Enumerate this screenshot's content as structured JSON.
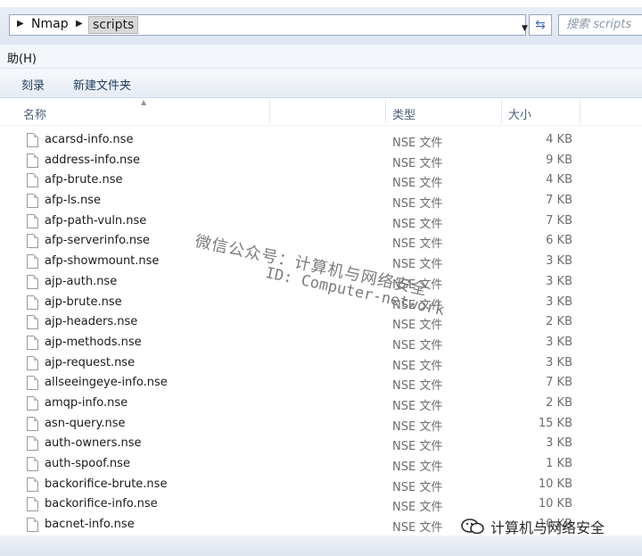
{
  "address": {
    "crumbs": [
      "Nmap",
      "scripts"
    ],
    "search_placeholder": "搜索 scripts"
  },
  "menu": {
    "help": "助(H)"
  },
  "toolbar": {
    "burn": "刻录",
    "new_folder": "新建文件夹"
  },
  "columns": {
    "name": "名称",
    "type": "类型",
    "size": "大小"
  },
  "files": [
    {
      "name": "acarsd-info.nse",
      "type": "NSE 文件",
      "size": "4 KB"
    },
    {
      "name": "address-info.nse",
      "type": "NSE 文件",
      "size": "9 KB"
    },
    {
      "name": "afp-brute.nse",
      "type": "NSE 文件",
      "size": "4 KB"
    },
    {
      "name": "afp-ls.nse",
      "type": "NSE 文件",
      "size": "7 KB"
    },
    {
      "name": "afp-path-vuln.nse",
      "type": "NSE 文件",
      "size": "7 KB"
    },
    {
      "name": "afp-serverinfo.nse",
      "type": "NSE 文件",
      "size": "6 KB"
    },
    {
      "name": "afp-showmount.nse",
      "type": "NSE 文件",
      "size": "3 KB"
    },
    {
      "name": "ajp-auth.nse",
      "type": "NSE 文件",
      "size": "3 KB"
    },
    {
      "name": "ajp-brute.nse",
      "type": "NSE 文件",
      "size": "3 KB"
    },
    {
      "name": "ajp-headers.nse",
      "type": "NSE 文件",
      "size": "2 KB"
    },
    {
      "name": "ajp-methods.nse",
      "type": "NSE 文件",
      "size": "3 KB"
    },
    {
      "name": "ajp-request.nse",
      "type": "NSE 文件",
      "size": "3 KB"
    },
    {
      "name": "allseeingeye-info.nse",
      "type": "NSE 文件",
      "size": "7 KB"
    },
    {
      "name": "amqp-info.nse",
      "type": "NSE 文件",
      "size": "2 KB"
    },
    {
      "name": "asn-query.nse",
      "type": "NSE 文件",
      "size": "15 KB"
    },
    {
      "name": "auth-owners.nse",
      "type": "NSE 文件",
      "size": "3 KB"
    },
    {
      "name": "auth-spoof.nse",
      "type": "NSE 文件",
      "size": "1 KB"
    },
    {
      "name": "backorifice-brute.nse",
      "type": "NSE 文件",
      "size": "10 KB"
    },
    {
      "name": "backorifice-info.nse",
      "type": "NSE 文件",
      "size": "10 KB"
    },
    {
      "name": "bacnet-info.nse",
      "type": "NSE 文件",
      "size": "10 KB"
    }
  ],
  "watermark": {
    "line1": "微信公众号：计算机与网络安全",
    "line2": "ID: Computer-network",
    "corner": "计算机与网络安全"
  }
}
